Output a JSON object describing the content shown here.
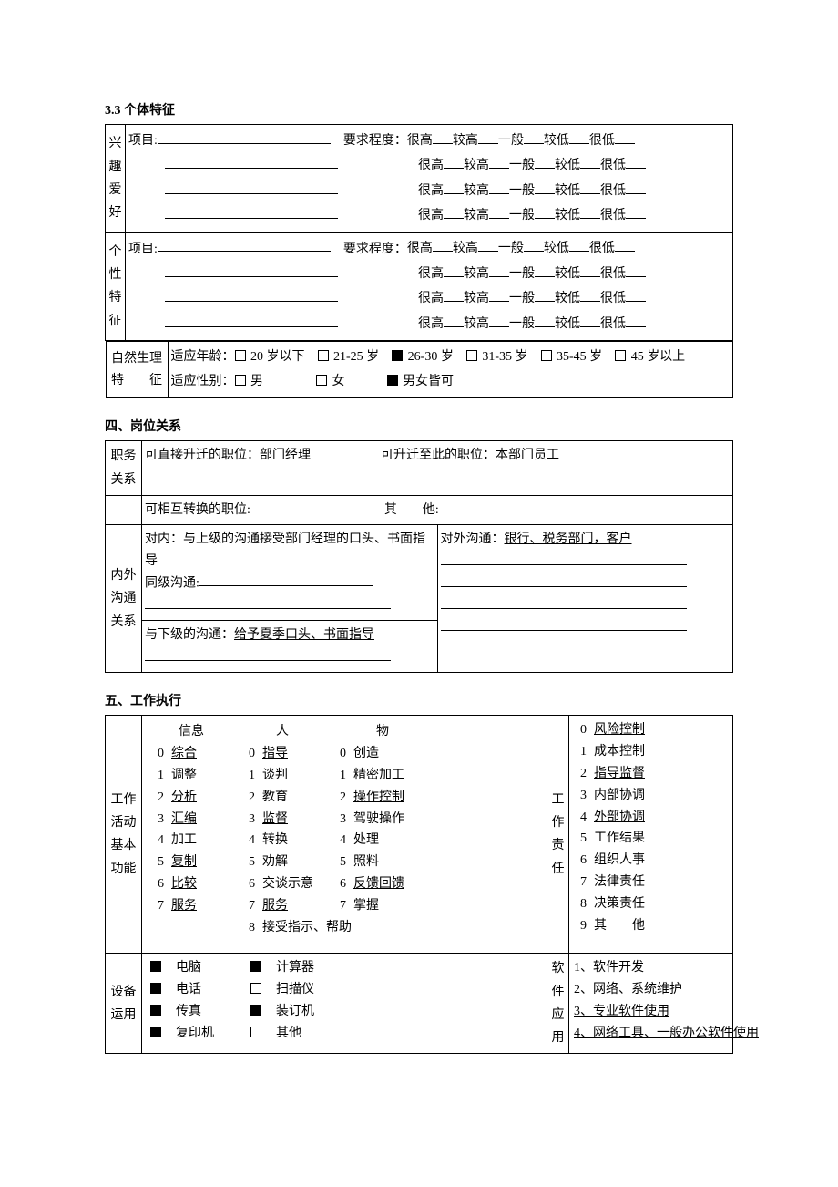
{
  "s33": {
    "title": "3.3  个体特征",
    "rows": {
      "r1": {
        "label_chars": [
          "兴",
          "趣",
          "爱",
          "好"
        ],
        "proj": "项目:",
        "req": "要求程度："
      },
      "r2": {
        "label_chars": [
          "个",
          "性",
          "特",
          "征"
        ],
        "proj": "项目:",
        "req": "要求程度："
      }
    },
    "ratings": [
      "很高",
      "较高",
      "一般",
      "较低",
      "很低"
    ],
    "nat": {
      "label_line1": "自然生理",
      "label_line2": "特　　征",
      "age_label": "适应年龄：",
      "age_opts": [
        {
          "text": "20 岁以下",
          "checked": false
        },
        {
          "text": "21-25 岁",
          "checked": false
        },
        {
          "text": "26-30 岁",
          "checked": true
        },
        {
          "text": "31-35 岁",
          "checked": false
        },
        {
          "text": "35-45 岁",
          "checked": false
        },
        {
          "text": "45 岁以上",
          "checked": false
        }
      ],
      "sex_label": "适应性别：",
      "sex_opts": [
        {
          "text": "男",
          "checked": false
        },
        {
          "text": "女",
          "checked": false
        },
        {
          "text": "男女皆可",
          "checked": true
        }
      ]
    }
  },
  "s4": {
    "title": "四、岗位关系",
    "pos": {
      "label": "职务关系",
      "direct": "可直接升迁的职位：部门经理",
      "from": "可升迁至此的职位：本部门员工",
      "swap": "可相互转换的职位:",
      "other": "其　　他:"
    },
    "comm": {
      "label": "内外沟通关系",
      "in1": "对内：与上级的沟通接受部门经理的口头、书面指导",
      "in2": "同级沟通:",
      "in3": "与下级的沟通：",
      "in3u": "给予夏季口头、书面指导",
      "out1": "对外沟通：",
      "out1u": "银行、税务部门，客户"
    }
  },
  "s5": {
    "title": "五、工作执行",
    "func": {
      "label": "工作活动基本功能",
      "h1": "信息",
      "h2": "人",
      "h3": "物",
      "c1": [
        {
          "n": "0",
          "t": "综合",
          "u": true
        },
        {
          "n": "1",
          "t": "调整",
          "u": false
        },
        {
          "n": "2",
          "t": "分析",
          "u": true
        },
        {
          "n": "3",
          "t": "汇编",
          "u": true
        },
        {
          "n": "4",
          "t": "加工",
          "u": false
        },
        {
          "n": "5",
          "t": "复制",
          "u": true
        },
        {
          "n": "6",
          "t": "比较",
          "u": true
        },
        {
          "n": "7",
          "t": "服务",
          "u": true
        }
      ],
      "c2": [
        {
          "n": "0",
          "t": "指导",
          "u": true
        },
        {
          "n": "1",
          "t": "谈判",
          "u": false
        },
        {
          "n": "2",
          "t": "教育",
          "u": false
        },
        {
          "n": "3",
          "t": "监督",
          "u": true
        },
        {
          "n": "4",
          "t": "转换",
          "u": false
        },
        {
          "n": "5",
          "t": "劝解",
          "u": false
        },
        {
          "n": "6",
          "t": "交谈示意",
          "u": false
        },
        {
          "n": "7",
          "t": "服务",
          "u": true
        },
        {
          "n": "8",
          "t": "接受指示、帮助",
          "u": false
        }
      ],
      "c3": [
        {
          "n": "0",
          "t": "创造",
          "u": false
        },
        {
          "n": "1",
          "t": "精密加工",
          "u": false
        },
        {
          "n": "2",
          "t": "操作控制",
          "u": true
        },
        {
          "n": "3",
          "t": "驾驶操作",
          "u": false
        },
        {
          "n": "4",
          "t": "处理",
          "u": false
        },
        {
          "n": "5",
          "t": "照料",
          "u": false
        },
        {
          "n": "6",
          "t": "反馈回馈",
          "u": true
        },
        {
          "n": "7",
          "t": "掌握",
          "u": false
        }
      ]
    },
    "resp": {
      "label": "工作责任",
      "items": [
        {
          "n": "0",
          "t": "风险控制",
          "u": true
        },
        {
          "n": "1",
          "t": "成本控制",
          "u": false
        },
        {
          "n": "2",
          "t": "指导监督",
          "u": true
        },
        {
          "n": "3",
          "t": "内部协调",
          "u": true
        },
        {
          "n": "4",
          "t": "外部协调",
          "u": true
        },
        {
          "n": "5",
          "t": "工作结果",
          "u": false
        },
        {
          "n": "6",
          "t": "组织人事",
          "u": false
        },
        {
          "n": "7",
          "t": "法律责任",
          "u": false
        },
        {
          "n": "8",
          "t": "决策责任",
          "u": false
        },
        {
          "n": "9",
          "t": "其　　他",
          "u": false
        }
      ]
    },
    "eq": {
      "label": "设备运用",
      "c1": [
        {
          "t": "电脑",
          "c": true
        },
        {
          "t": "电话",
          "c": true
        },
        {
          "t": "传真",
          "c": true
        },
        {
          "t": "复印机",
          "c": true
        }
      ],
      "c2": [
        {
          "t": "计算器",
          "c": true
        },
        {
          "t": "扫描仪",
          "c": false
        },
        {
          "t": "装订机",
          "c": true
        },
        {
          "t": "其他",
          "c": false
        }
      ]
    },
    "soft": {
      "label": "软件应用",
      "items": [
        {
          "n": "1、",
          "t": "软件开发",
          "u": false
        },
        {
          "n": "2、",
          "t": "网络、系统维护",
          "u": false
        },
        {
          "n": "3、",
          "t": "专业软件使用",
          "u": true
        },
        {
          "n": "4、",
          "t": "网络工具、一般办公软件使用",
          "u": true
        }
      ]
    }
  }
}
